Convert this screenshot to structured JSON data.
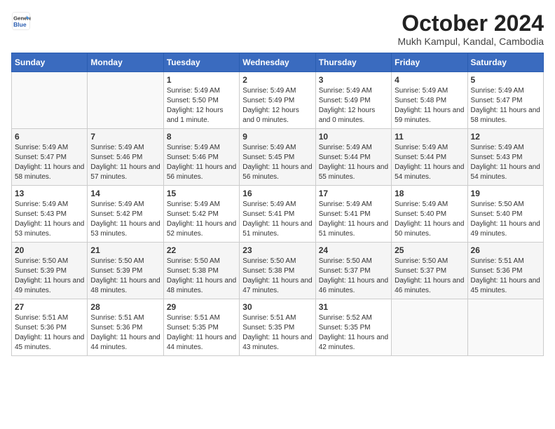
{
  "logo": {
    "general": "General",
    "blue": "Blue"
  },
  "title": "October 2024",
  "location": "Mukh Kampul, Kandal, Cambodia",
  "weekdays": [
    "Sunday",
    "Monday",
    "Tuesday",
    "Wednesday",
    "Thursday",
    "Friday",
    "Saturday"
  ],
  "weeks": [
    [
      {
        "day": "",
        "sunrise": "",
        "sunset": "",
        "daylight": ""
      },
      {
        "day": "",
        "sunrise": "",
        "sunset": "",
        "daylight": ""
      },
      {
        "day": "1",
        "sunrise": "Sunrise: 5:49 AM",
        "sunset": "Sunset: 5:50 PM",
        "daylight": "Daylight: 12 hours and 1 minute."
      },
      {
        "day": "2",
        "sunrise": "Sunrise: 5:49 AM",
        "sunset": "Sunset: 5:49 PM",
        "daylight": "Daylight: 12 hours and 0 minutes."
      },
      {
        "day": "3",
        "sunrise": "Sunrise: 5:49 AM",
        "sunset": "Sunset: 5:49 PM",
        "daylight": "Daylight: 12 hours and 0 minutes."
      },
      {
        "day": "4",
        "sunrise": "Sunrise: 5:49 AM",
        "sunset": "Sunset: 5:48 PM",
        "daylight": "Daylight: 11 hours and 59 minutes."
      },
      {
        "day": "5",
        "sunrise": "Sunrise: 5:49 AM",
        "sunset": "Sunset: 5:47 PM",
        "daylight": "Daylight: 11 hours and 58 minutes."
      }
    ],
    [
      {
        "day": "6",
        "sunrise": "Sunrise: 5:49 AM",
        "sunset": "Sunset: 5:47 PM",
        "daylight": "Daylight: 11 hours and 58 minutes."
      },
      {
        "day": "7",
        "sunrise": "Sunrise: 5:49 AM",
        "sunset": "Sunset: 5:46 PM",
        "daylight": "Daylight: 11 hours and 57 minutes."
      },
      {
        "day": "8",
        "sunrise": "Sunrise: 5:49 AM",
        "sunset": "Sunset: 5:46 PM",
        "daylight": "Daylight: 11 hours and 56 minutes."
      },
      {
        "day": "9",
        "sunrise": "Sunrise: 5:49 AM",
        "sunset": "Sunset: 5:45 PM",
        "daylight": "Daylight: 11 hours and 56 minutes."
      },
      {
        "day": "10",
        "sunrise": "Sunrise: 5:49 AM",
        "sunset": "Sunset: 5:44 PM",
        "daylight": "Daylight: 11 hours and 55 minutes."
      },
      {
        "day": "11",
        "sunrise": "Sunrise: 5:49 AM",
        "sunset": "Sunset: 5:44 PM",
        "daylight": "Daylight: 11 hours and 54 minutes."
      },
      {
        "day": "12",
        "sunrise": "Sunrise: 5:49 AM",
        "sunset": "Sunset: 5:43 PM",
        "daylight": "Daylight: 11 hours and 54 minutes."
      }
    ],
    [
      {
        "day": "13",
        "sunrise": "Sunrise: 5:49 AM",
        "sunset": "Sunset: 5:43 PM",
        "daylight": "Daylight: 11 hours and 53 minutes."
      },
      {
        "day": "14",
        "sunrise": "Sunrise: 5:49 AM",
        "sunset": "Sunset: 5:42 PM",
        "daylight": "Daylight: 11 hours and 53 minutes."
      },
      {
        "day": "15",
        "sunrise": "Sunrise: 5:49 AM",
        "sunset": "Sunset: 5:42 PM",
        "daylight": "Daylight: 11 hours and 52 minutes."
      },
      {
        "day": "16",
        "sunrise": "Sunrise: 5:49 AM",
        "sunset": "Sunset: 5:41 PM",
        "daylight": "Daylight: 11 hours and 51 minutes."
      },
      {
        "day": "17",
        "sunrise": "Sunrise: 5:49 AM",
        "sunset": "Sunset: 5:41 PM",
        "daylight": "Daylight: 11 hours and 51 minutes."
      },
      {
        "day": "18",
        "sunrise": "Sunrise: 5:49 AM",
        "sunset": "Sunset: 5:40 PM",
        "daylight": "Daylight: 11 hours and 50 minutes."
      },
      {
        "day": "19",
        "sunrise": "Sunrise: 5:50 AM",
        "sunset": "Sunset: 5:40 PM",
        "daylight": "Daylight: 11 hours and 49 minutes."
      }
    ],
    [
      {
        "day": "20",
        "sunrise": "Sunrise: 5:50 AM",
        "sunset": "Sunset: 5:39 PM",
        "daylight": "Daylight: 11 hours and 49 minutes."
      },
      {
        "day": "21",
        "sunrise": "Sunrise: 5:50 AM",
        "sunset": "Sunset: 5:39 PM",
        "daylight": "Daylight: 11 hours and 48 minutes."
      },
      {
        "day": "22",
        "sunrise": "Sunrise: 5:50 AM",
        "sunset": "Sunset: 5:38 PM",
        "daylight": "Daylight: 11 hours and 48 minutes."
      },
      {
        "day": "23",
        "sunrise": "Sunrise: 5:50 AM",
        "sunset": "Sunset: 5:38 PM",
        "daylight": "Daylight: 11 hours and 47 minutes."
      },
      {
        "day": "24",
        "sunrise": "Sunrise: 5:50 AM",
        "sunset": "Sunset: 5:37 PM",
        "daylight": "Daylight: 11 hours and 46 minutes."
      },
      {
        "day": "25",
        "sunrise": "Sunrise: 5:50 AM",
        "sunset": "Sunset: 5:37 PM",
        "daylight": "Daylight: 11 hours and 46 minutes."
      },
      {
        "day": "26",
        "sunrise": "Sunrise: 5:51 AM",
        "sunset": "Sunset: 5:36 PM",
        "daylight": "Daylight: 11 hours and 45 minutes."
      }
    ],
    [
      {
        "day": "27",
        "sunrise": "Sunrise: 5:51 AM",
        "sunset": "Sunset: 5:36 PM",
        "daylight": "Daylight: 11 hours and 45 minutes."
      },
      {
        "day": "28",
        "sunrise": "Sunrise: 5:51 AM",
        "sunset": "Sunset: 5:36 PM",
        "daylight": "Daylight: 11 hours and 44 minutes."
      },
      {
        "day": "29",
        "sunrise": "Sunrise: 5:51 AM",
        "sunset": "Sunset: 5:35 PM",
        "daylight": "Daylight: 11 hours and 44 minutes."
      },
      {
        "day": "30",
        "sunrise": "Sunrise: 5:51 AM",
        "sunset": "Sunset: 5:35 PM",
        "daylight": "Daylight: 11 hours and 43 minutes."
      },
      {
        "day": "31",
        "sunrise": "Sunrise: 5:52 AM",
        "sunset": "Sunset: 5:35 PM",
        "daylight": "Daylight: 11 hours and 42 minutes."
      },
      {
        "day": "",
        "sunrise": "",
        "sunset": "",
        "daylight": ""
      },
      {
        "day": "",
        "sunrise": "",
        "sunset": "",
        "daylight": ""
      }
    ]
  ]
}
